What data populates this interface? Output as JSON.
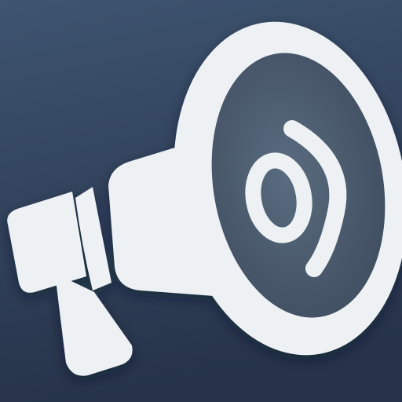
{
  "icon": {
    "name": "megaphone-icon",
    "colors": {
      "background_top": "#3e5470",
      "background_bottom": "#26334a",
      "megaphone": "#eef1f4",
      "bell_inner_light": "#5a6c80",
      "bell_inner_dark": "#3c4a5b"
    }
  }
}
